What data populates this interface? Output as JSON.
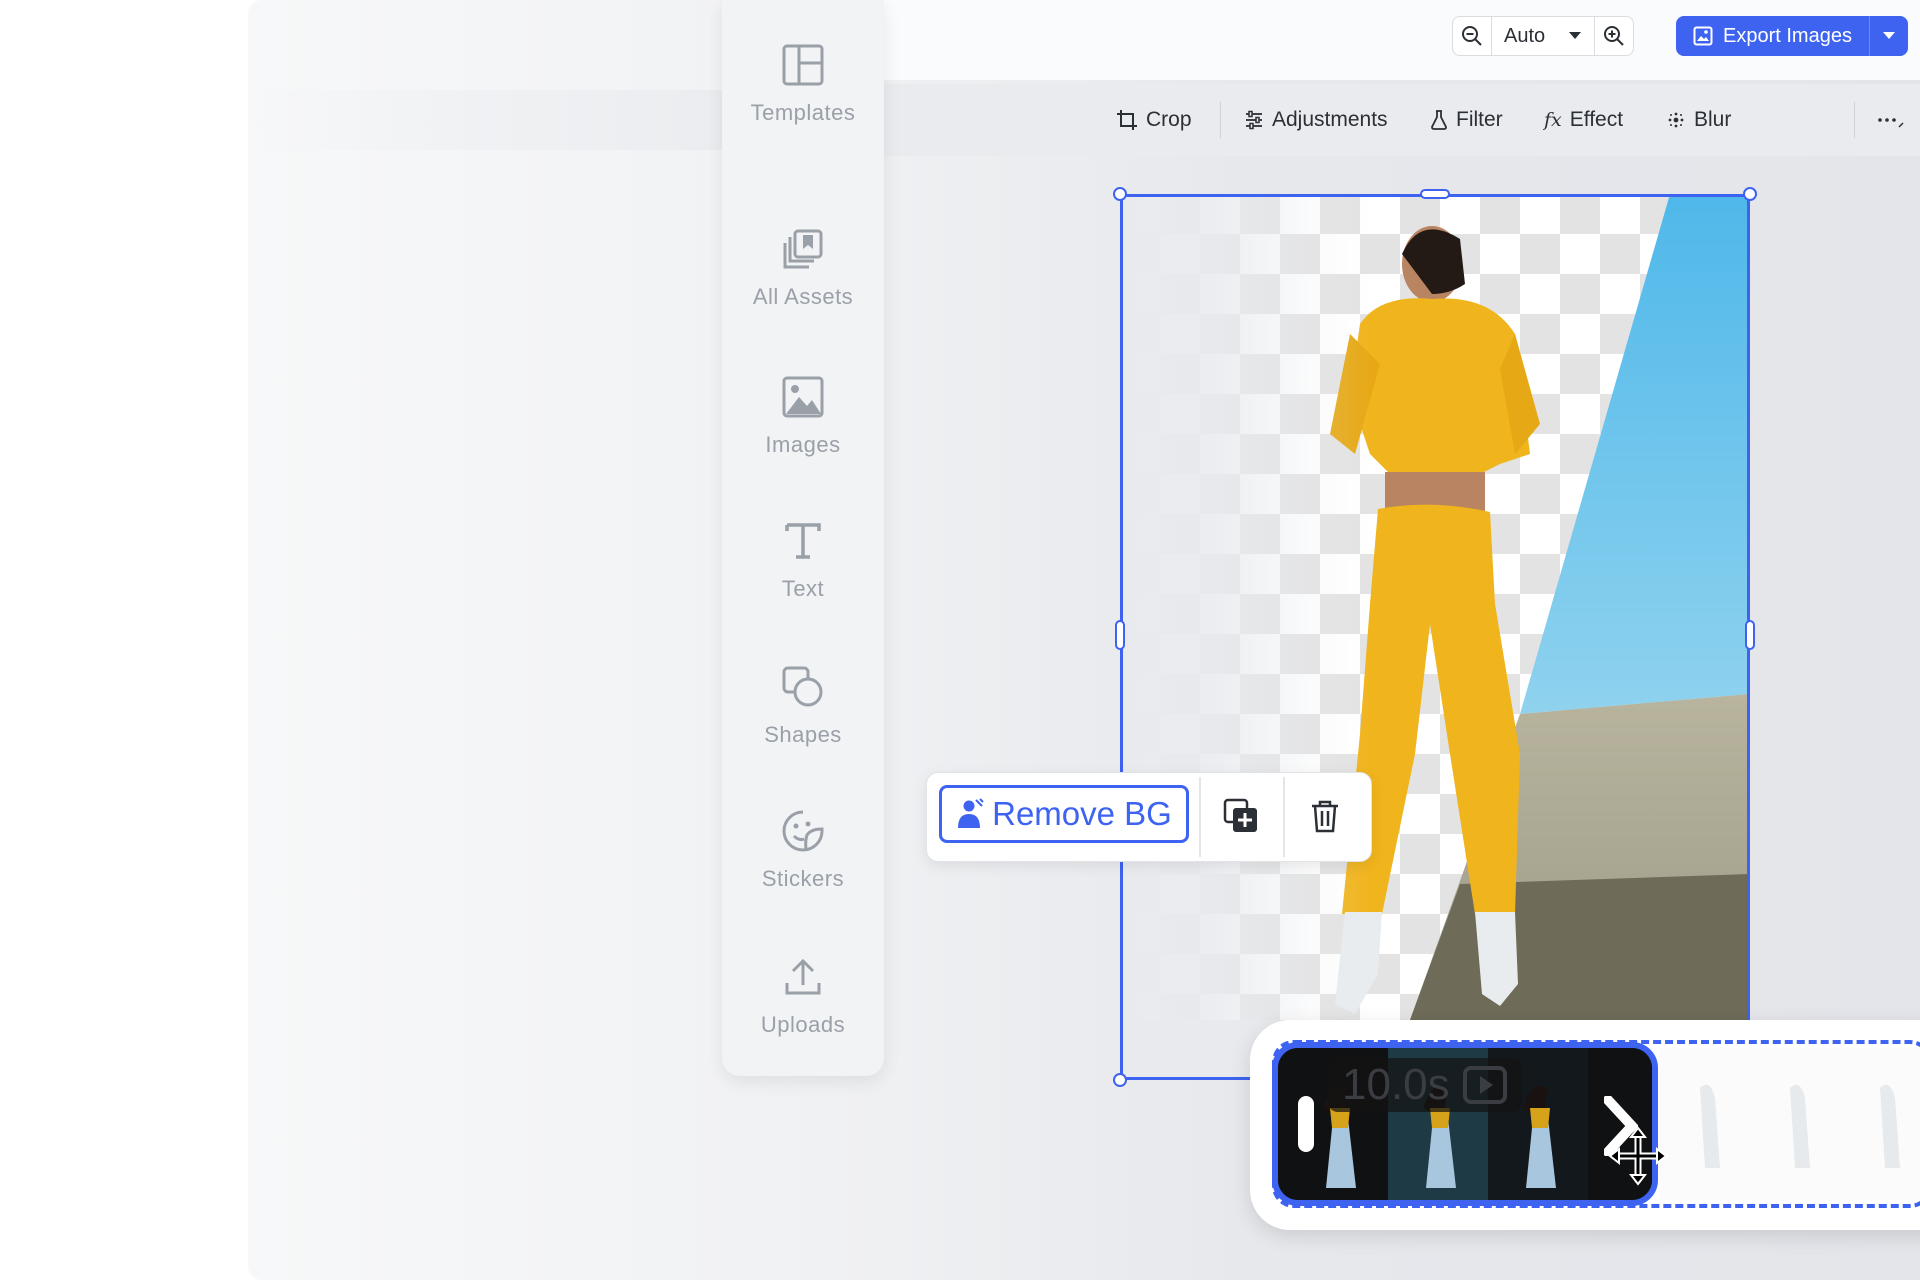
{
  "zoom": {
    "value": "Auto"
  },
  "export": {
    "label": "Export Images"
  },
  "toolbar": {
    "crop": "Crop",
    "adjustments": "Adjustments",
    "filter": "Filter",
    "effect_glyph": "fx",
    "effect": "Effect",
    "blur": "Blur"
  },
  "sidebar": {
    "items": [
      {
        "label": "Templates",
        "icon": "layout-icon"
      },
      {
        "label": "All Assets",
        "icon": "assets-icon"
      },
      {
        "label": "Images",
        "icon": "image-icon"
      },
      {
        "label": "Text",
        "icon": "text-icon"
      },
      {
        "label": "Shapes",
        "icon": "shapes-icon"
      },
      {
        "label": "Stickers",
        "icon": "sticker-icon"
      },
      {
        "label": "Uploads",
        "icon": "upload-icon"
      }
    ]
  },
  "context_menu": {
    "remove_bg": "Remove BG"
  },
  "timeline": {
    "duration": "10.0s"
  },
  "colors": {
    "accent": "#3d63f0",
    "sidebar_text": "#9aa0a8"
  }
}
